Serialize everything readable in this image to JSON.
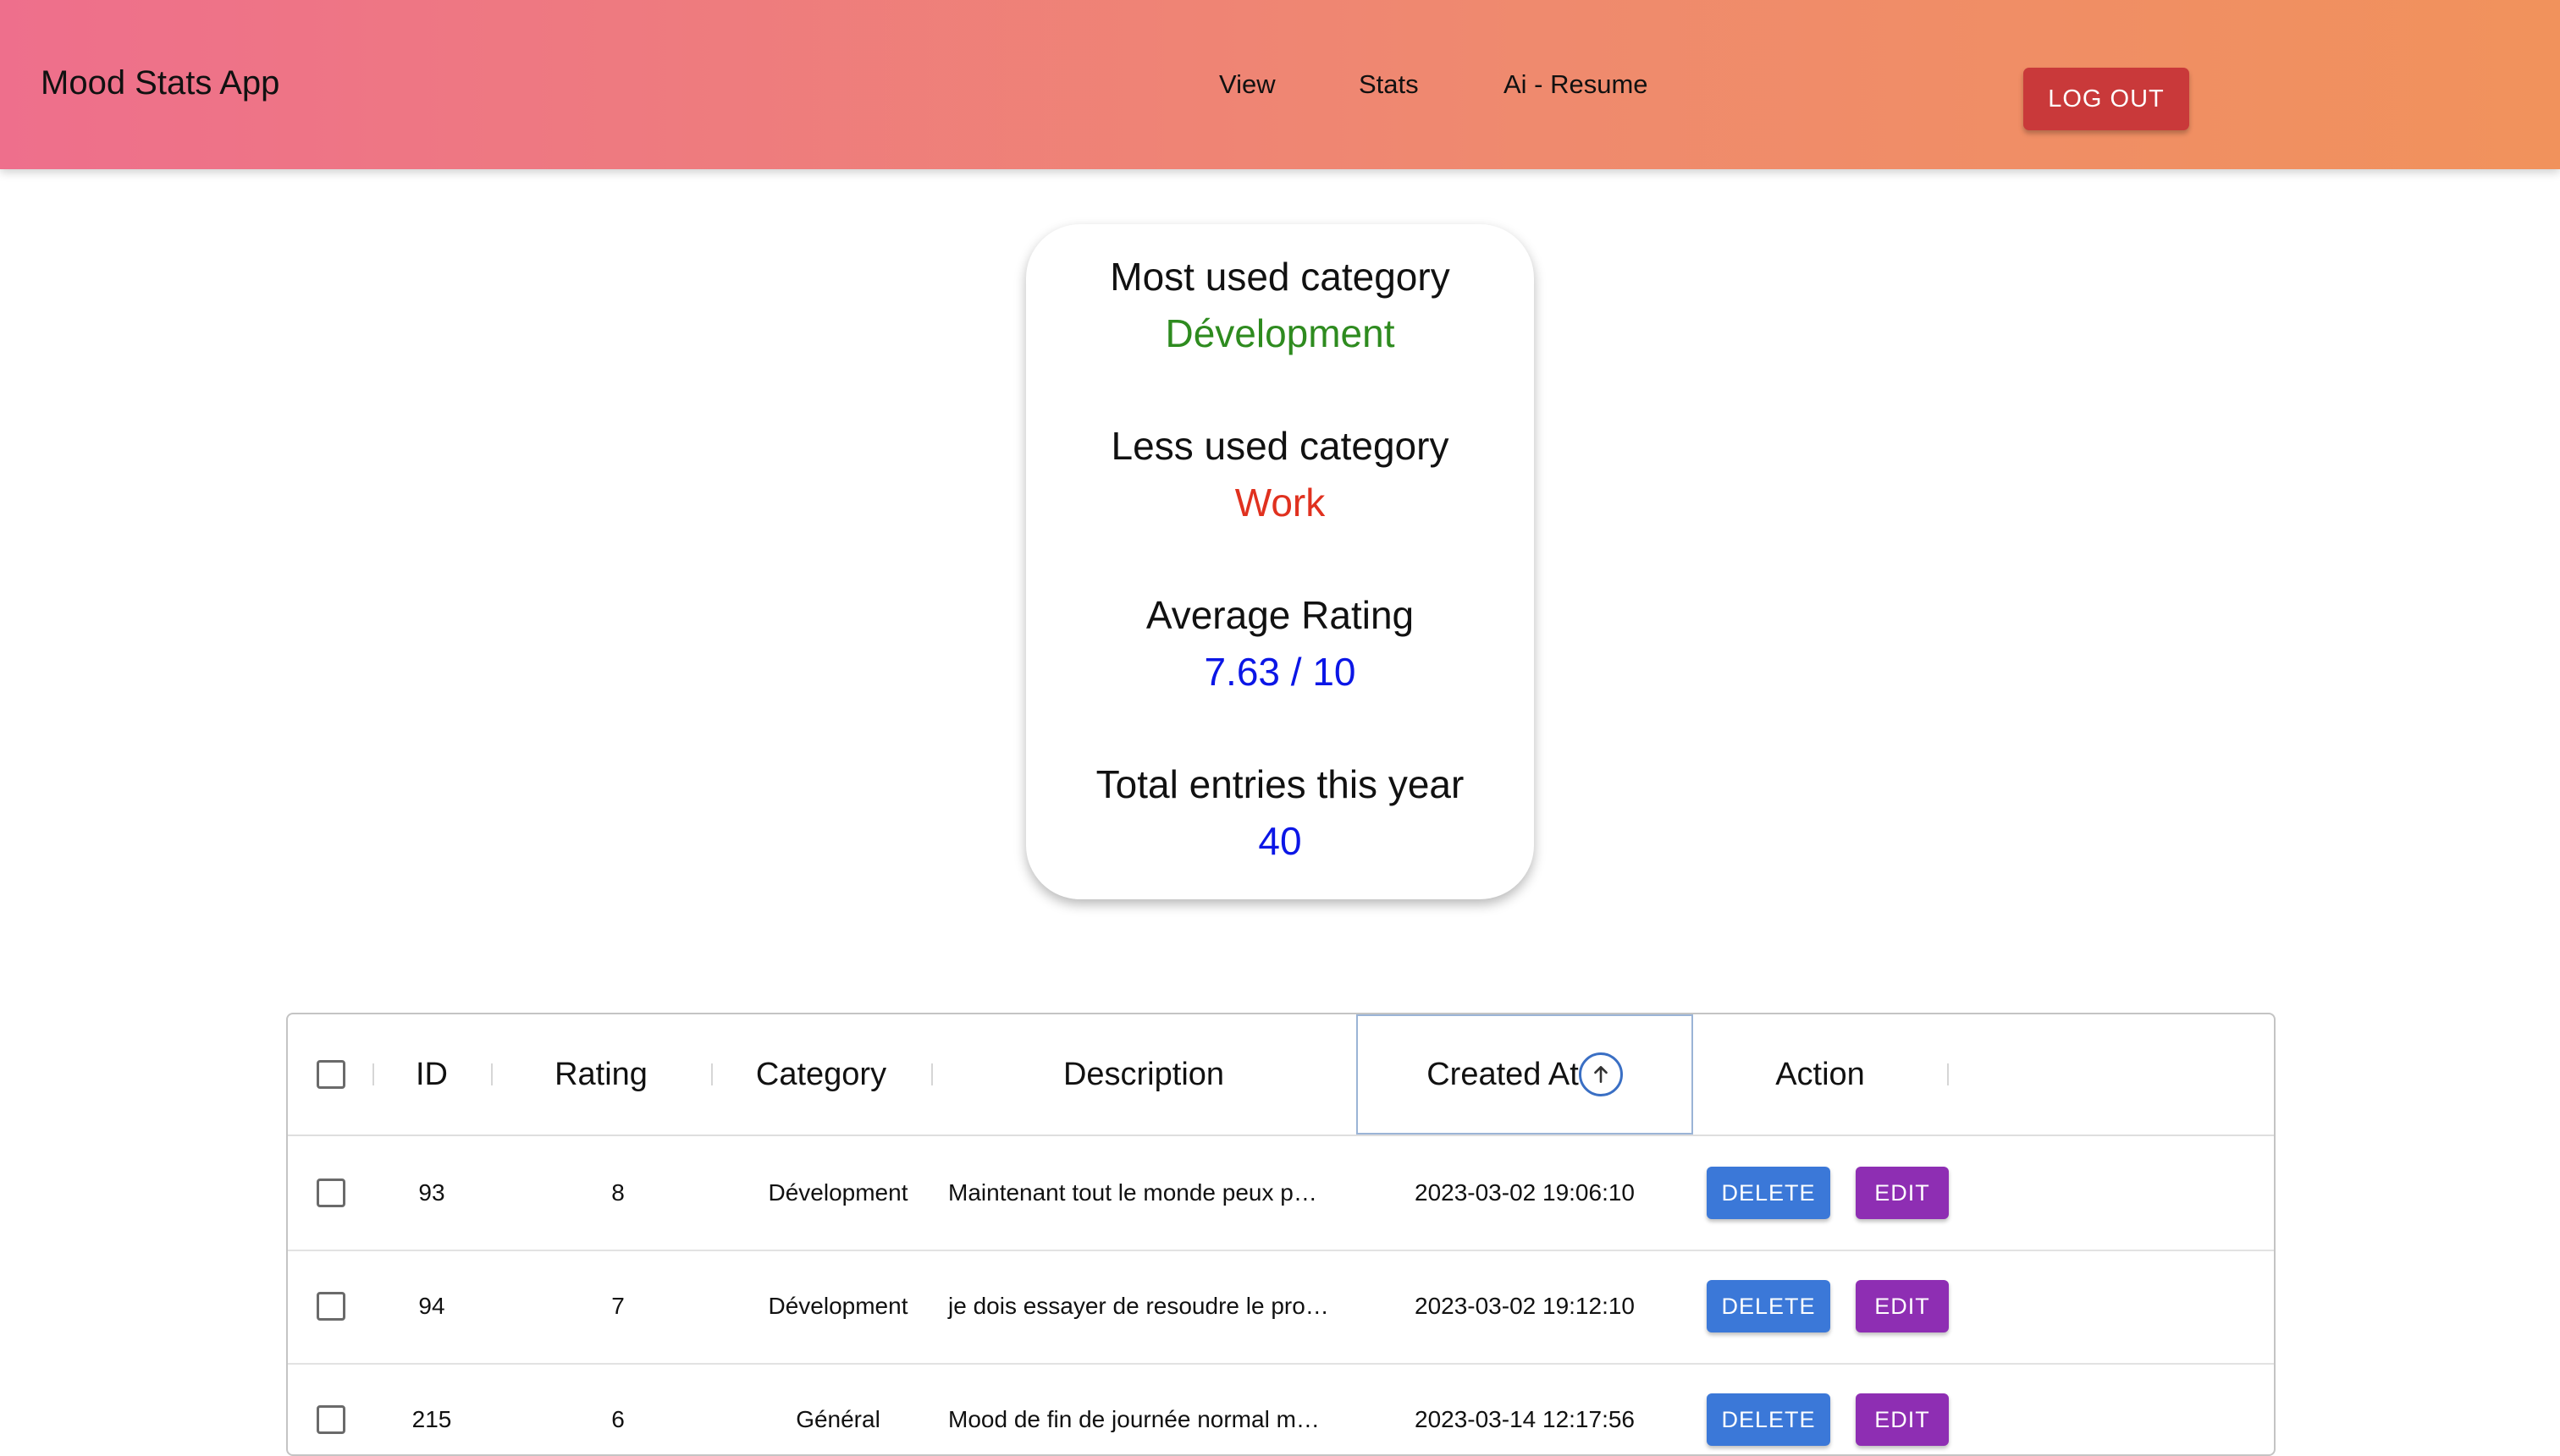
{
  "app": {
    "title": "Mood Stats App"
  },
  "nav": {
    "view": "View",
    "stats": "Stats",
    "ai_resume": "Ai - Resume",
    "logout": "LOG OUT"
  },
  "stats": {
    "most_used_label": "Most used category",
    "most_used_value": "Dévelopment",
    "less_used_label": "Less used category",
    "less_used_value": "Work",
    "average_label": "Average Rating",
    "average_value": "7.63 / 10",
    "total_label": "Total entries this year",
    "total_value": "40"
  },
  "colors": {
    "most_used": "#2e8b1f",
    "less_used": "#e0311f",
    "numeric": "#0b16e6",
    "header_gradient_start": "#ee6f8c",
    "header_gradient_end": "#f1925c",
    "logout": "#c9393a",
    "delete": "#3b78d8",
    "edit": "#8e2eb3"
  },
  "table": {
    "columns": {
      "id": "ID",
      "rating": "Rating",
      "category": "Category",
      "description": "Description",
      "created_at": "Created At",
      "action": "Action"
    },
    "sort_icon": "arrow-up-icon",
    "rows": [
      {
        "id": "93",
        "rating": "8",
        "category": "Dévelopment",
        "description": "Maintenant tout le monde peux p…",
        "created_at": "2023-03-02 19:06:10",
        "delete": "DELETE",
        "edit": "EDIT"
      },
      {
        "id": "94",
        "rating": "7",
        "category": "Dévelopment",
        "description": "je dois essayer de resoudre le pro…",
        "created_at": "2023-03-02 19:12:10",
        "delete": "DELETE",
        "edit": "EDIT"
      },
      {
        "id": "215",
        "rating": "6",
        "category": "Général",
        "description": "Mood de fin de journée normal m…",
        "created_at": "2023-03-14 12:17:56",
        "delete": "DELETE",
        "edit": "EDIT"
      }
    ]
  }
}
